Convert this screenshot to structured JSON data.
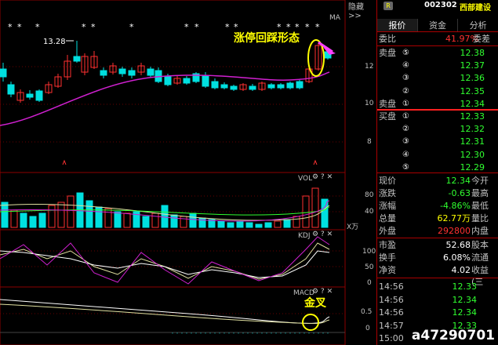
{
  "stock": {
    "code": "002302",
    "name": "西部建设",
    "badge": "R"
  },
  "topbar": {
    "hide_label": "隐藏>>"
  },
  "tabs": [
    {
      "label": "报价",
      "active": true
    },
    {
      "label": "资金",
      "active": false
    },
    {
      "label": "分析",
      "active": false
    }
  ],
  "weibi": {
    "label": "委比",
    "value": "41.97%",
    "tail": "委差"
  },
  "sell_orders": [
    {
      "label": "卖盘",
      "circ": "⑤",
      "price": "12.38"
    },
    {
      "label": "",
      "circ": "④",
      "price": "12.37"
    },
    {
      "label": "",
      "circ": "③",
      "price": "12.36"
    },
    {
      "label": "",
      "circ": "②",
      "price": "12.35"
    },
    {
      "label": "卖盘",
      "circ": "①",
      "price": "12.34"
    }
  ],
  "buy_orders": [
    {
      "label": "买盘",
      "circ": "①",
      "price": "12.33"
    },
    {
      "label": "",
      "circ": "②",
      "price": "12.32"
    },
    {
      "label": "",
      "circ": "③",
      "price": "12.31"
    },
    {
      "label": "",
      "circ": "④",
      "price": "12.30"
    },
    {
      "label": "",
      "circ": "⑤",
      "price": "12.29"
    }
  ],
  "quote": [
    {
      "l": "现价",
      "v": "12.34",
      "v_color": "dn",
      "t": "今开"
    },
    {
      "l": "涨跌",
      "v": "-0.63",
      "v_color": "dn",
      "t": "最高"
    },
    {
      "l": "涨幅",
      "v": "-4.86%",
      "v_color": "dn",
      "t": "最低"
    },
    {
      "l": "总量",
      "v": "62.77万",
      "v_color": "yl",
      "t": "量比"
    },
    {
      "l": "外盘",
      "v": "292800",
      "v_color": "up",
      "t": "内盘"
    }
  ],
  "fundamentals": [
    {
      "l": "市盈",
      "v": "52.68",
      "t": "股本"
    },
    {
      "l": "换手",
      "v": "6.08%",
      "t": "流通"
    },
    {
      "l": "净资",
      "v": "4.02",
      "t": "收益(三"
    }
  ],
  "ticks": [
    {
      "time": "14:56",
      "price": "12.33"
    },
    {
      "time": "14:56",
      "price": "12.34"
    },
    {
      "time": "14:56",
      "price": "12.34"
    },
    {
      "time": "14:57",
      "price": "12.33"
    },
    {
      "time": "15:00",
      "price": ""
    }
  ],
  "chart": {
    "ma_label": "MA",
    "high_label": "13.28",
    "price_ticks": [
      "12",
      "10",
      "8"
    ],
    "vol": {
      "label": "VOL",
      "ticks": [
        "80",
        "40"
      ],
      "unit": "X万"
    },
    "kdj": {
      "label": "KDJ",
      "ticks": [
        "100",
        "50",
        "0"
      ]
    },
    "macd": {
      "label": "MACD",
      "ticks": [
        "0.5",
        "0"
      ]
    },
    "annotation_top": "涨停回踩形态",
    "annotation_macd": "金叉",
    "watermark": "a47290701"
  },
  "colors": {
    "up": "#ff3030",
    "down": "#00e0e0",
    "ma": "#d020d0",
    "ma_yellow": "#e0e0a0"
  }
}
